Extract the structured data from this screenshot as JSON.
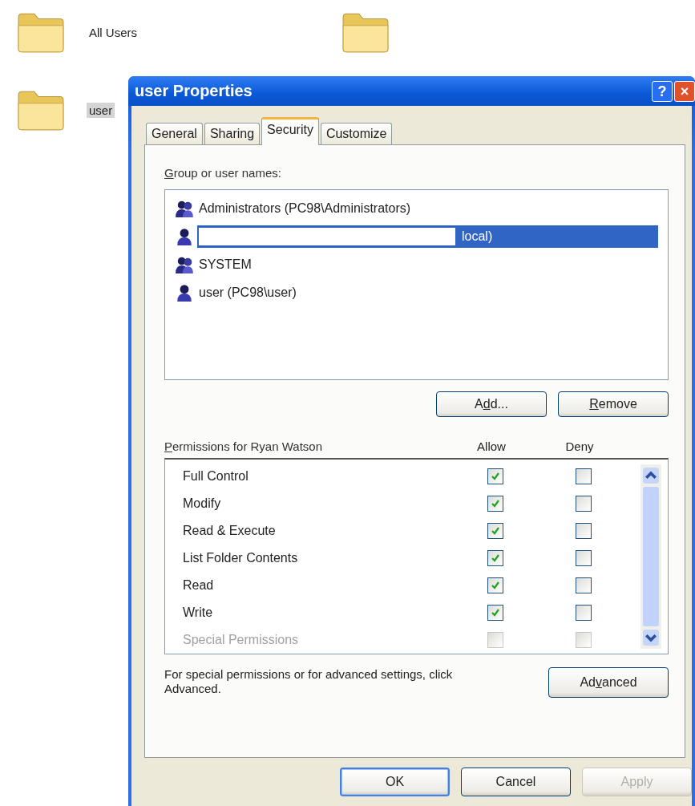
{
  "desktop_items": [
    {
      "label": "All Users",
      "selected": false
    },
    {
      "selected": false
    },
    {
      "label": "user",
      "selected": true
    }
  ],
  "dialog": {
    "title": "user Properties",
    "help_glyph": "?",
    "close_glyph": "×",
    "tabs": [
      {
        "label": "General",
        "selected": false
      },
      {
        "label": "Sharing",
        "selected": false
      },
      {
        "label": "Security",
        "selected": true
      },
      {
        "label": "Customize",
        "selected": false
      }
    ],
    "group_label": {
      "key": "G",
      "after": "roup or user names:"
    },
    "users": [
      {
        "name": "Administrators (PC98\\Administrators)",
        "kind": "group",
        "selected": false,
        "redacted": false
      },
      {
        "name": "local)",
        "kind": "user",
        "selected": true,
        "redacted": true
      },
      {
        "name": "SYSTEM",
        "kind": "group",
        "selected": false,
        "redacted": false
      },
      {
        "name": "user (PC98\\user)",
        "kind": "user",
        "selected": false,
        "redacted": false
      }
    ],
    "list_buttons": [
      {
        "before": "A",
        "key": "d",
        "after": "d..."
      },
      {
        "key": "R",
        "after": "emove"
      }
    ],
    "permissions_label": {
      "key": "P",
      "after": "ermissions for Ryan Watson"
    },
    "columns": [
      "Allow",
      "Deny"
    ],
    "permissions": [
      {
        "name": "Full Control",
        "allow": true,
        "deny": false,
        "disabled": false
      },
      {
        "name": "Modify",
        "allow": true,
        "deny": false,
        "disabled": false
      },
      {
        "name": "Read & Execute",
        "allow": true,
        "deny": false,
        "disabled": false
      },
      {
        "name": "List Folder Contents",
        "allow": true,
        "deny": false,
        "disabled": false
      },
      {
        "name": "Read",
        "allow": true,
        "deny": false,
        "disabled": false
      },
      {
        "name": "Write",
        "allow": true,
        "deny": false,
        "disabled": false
      },
      {
        "name": "Special Permissions",
        "allow": false,
        "deny": false,
        "disabled": true
      }
    ],
    "advanced_text": "For special permissions or for advanced settings, click Advanced.",
    "advanced_button": {
      "before": "Ad",
      "key": "v",
      "after": "anced"
    },
    "buttons": [
      {
        "label": "OK",
        "default": true,
        "disabled": false
      },
      {
        "label": "Cancel",
        "default": false,
        "disabled": false
      },
      {
        "label": "Apply",
        "default": false,
        "disabled": true
      }
    ]
  }
}
